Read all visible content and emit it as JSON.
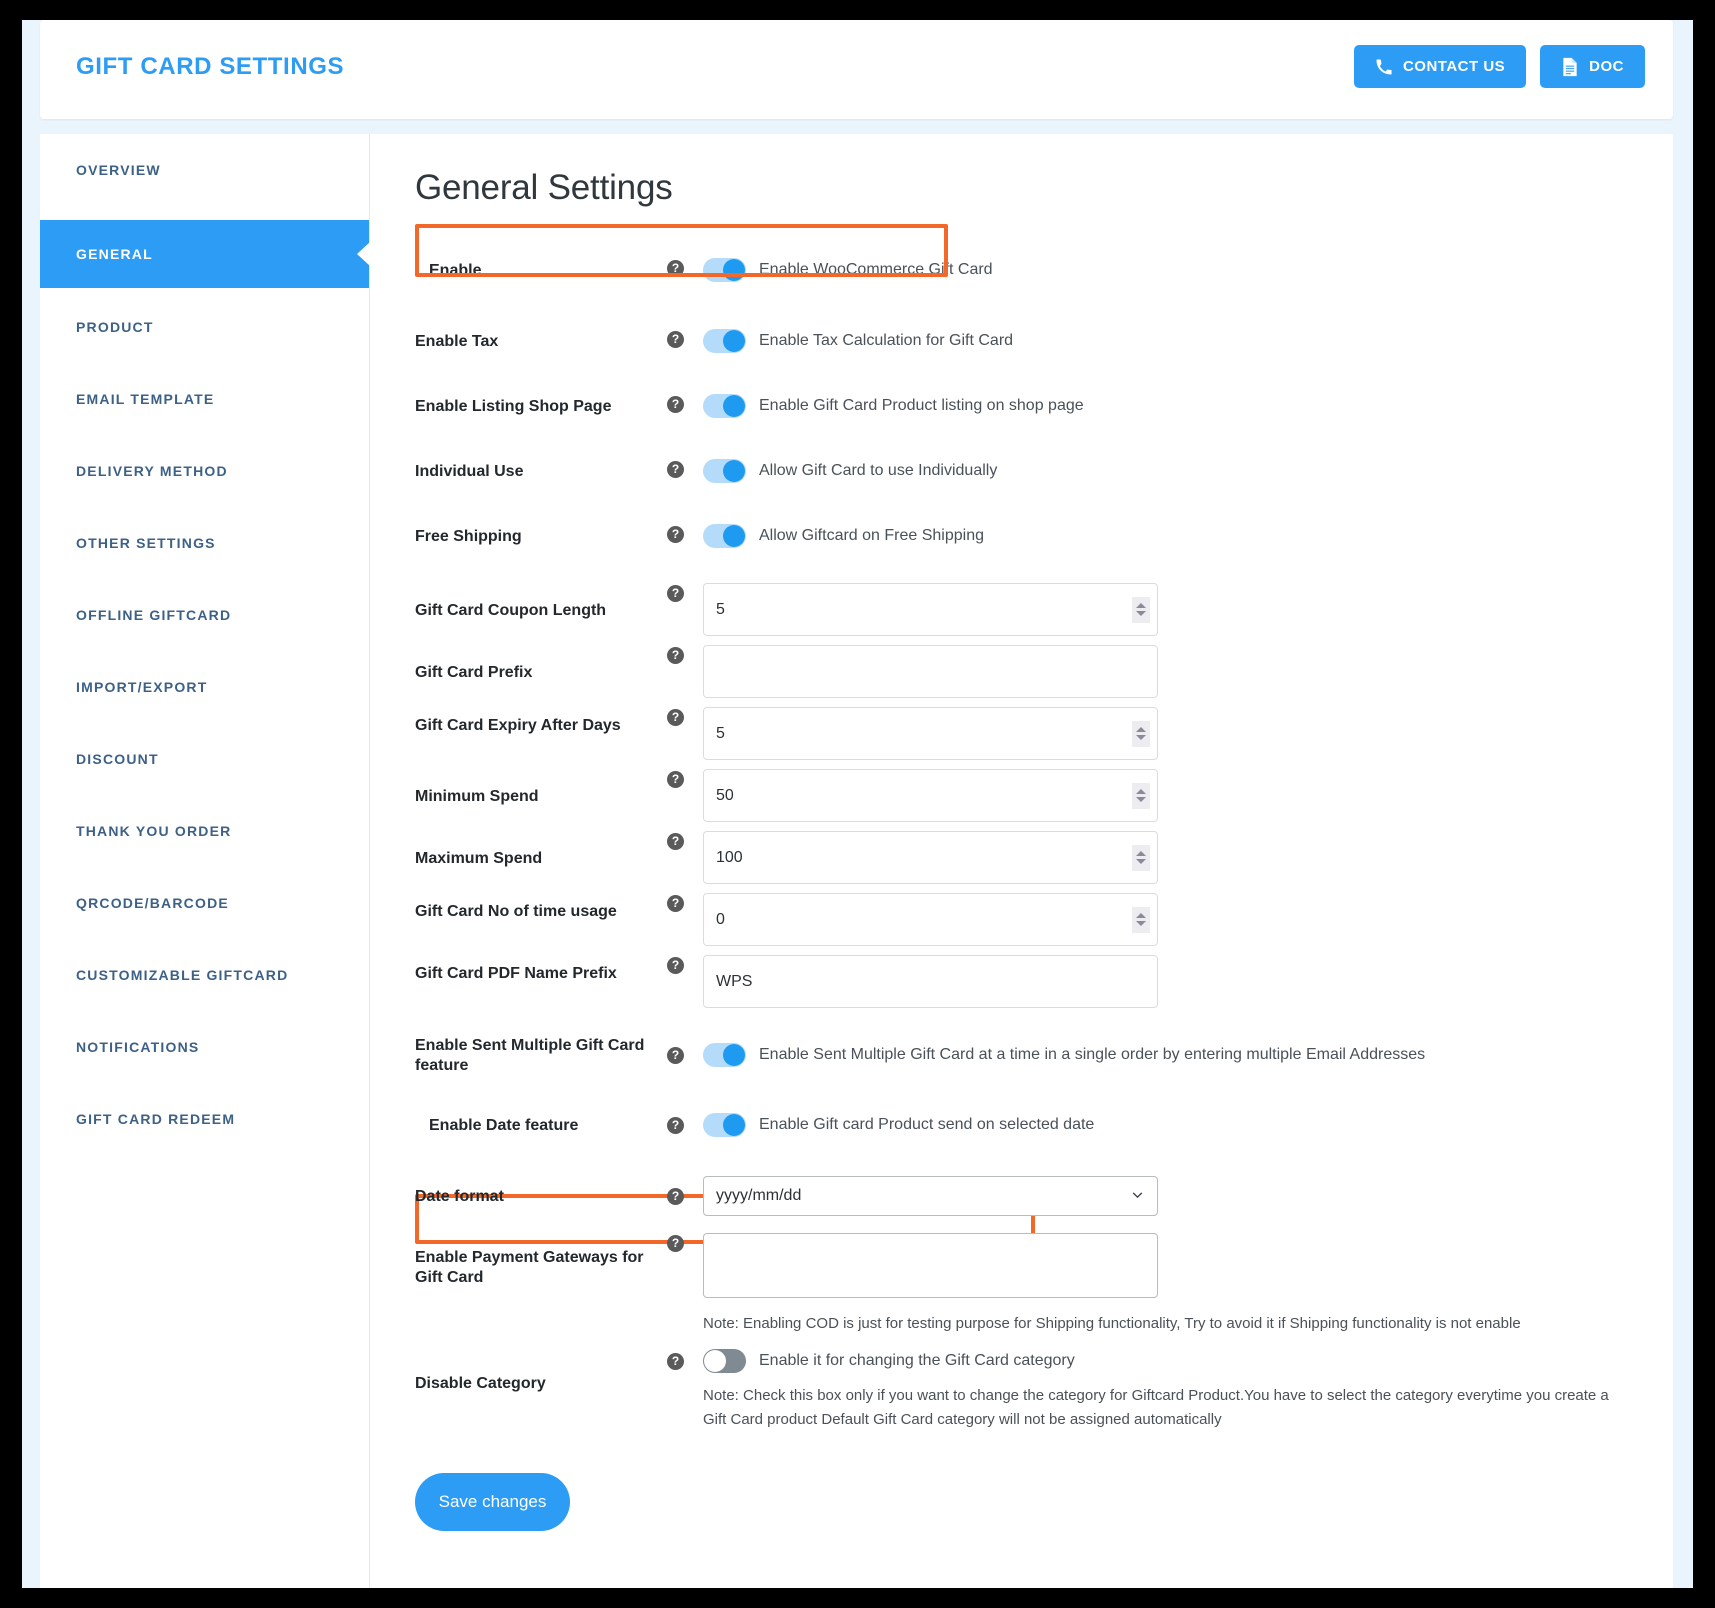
{
  "header": {
    "title": "GIFT CARD SETTINGS",
    "contact_label": "CONTACT US",
    "doc_label": "DOC",
    "accent_color": "#2d9cf5"
  },
  "sidebar": {
    "items": [
      {
        "label": "OVERVIEW",
        "active": false
      },
      {
        "label": "GENERAL",
        "active": true
      },
      {
        "label": "PRODUCT",
        "active": false
      },
      {
        "label": "EMAIL TEMPLATE",
        "active": false
      },
      {
        "label": "DELIVERY METHOD",
        "active": false
      },
      {
        "label": "OTHER SETTINGS",
        "active": false
      },
      {
        "label": "OFFLINE GIFTCARD",
        "active": false
      },
      {
        "label": "IMPORT/EXPORT",
        "active": false
      },
      {
        "label": "DISCOUNT",
        "active": false
      },
      {
        "label": "THANK YOU ORDER",
        "active": false
      },
      {
        "label": "QRCODE/BARCODE",
        "active": false
      },
      {
        "label": "CUSTOMIZABLE GIFTCARD",
        "active": false
      },
      {
        "label": "NOTIFICATIONS",
        "active": false
      },
      {
        "label": "GIFT CARD REDEEM",
        "active": false
      }
    ]
  },
  "main": {
    "title": "General Settings",
    "help_glyph": "?",
    "rows": {
      "enable": {
        "label": "Enable",
        "toggle_text": "Enable WooCommerce Gift Card",
        "toggle_on": true,
        "highlighted": true
      },
      "enable_tax": {
        "label": "Enable Tax",
        "toggle_text": "Enable Tax Calculation for Gift Card",
        "toggle_on": true
      },
      "enable_listing_shop_page": {
        "label": "Enable Listing Shop Page",
        "toggle_text": "Enable Gift Card Product listing on shop page",
        "toggle_on": true
      },
      "individual_use": {
        "label": "Individual Use",
        "toggle_text": "Allow Gift Card to use Individually",
        "toggle_on": true
      },
      "free_shipping": {
        "label": "Free Shipping",
        "toggle_text": "Allow Giftcard on Free Shipping",
        "toggle_on": true
      },
      "coupon_length": {
        "label": "Gift Card Coupon Length",
        "value": "5"
      },
      "prefix": {
        "label": "Gift Card Prefix",
        "value": ""
      },
      "expiry_days": {
        "label": "Gift Card Expiry After Days",
        "value": "5"
      },
      "minimum_spend": {
        "label": "Minimum Spend",
        "value": "50"
      },
      "maximum_spend": {
        "label": "Maximum Spend",
        "value": "100"
      },
      "no_of_time_usage": {
        "label": "Gift Card No of time usage",
        "value": "0"
      },
      "pdf_name_prefix": {
        "label": "Gift Card PDF Name Prefix",
        "value": "WPS"
      },
      "sent_multiple": {
        "label": "Enable Sent Multiple Gift Card feature",
        "toggle_text": "Enable Sent Multiple Gift Card at a time in a single order by entering multiple Email Addresses",
        "toggle_on": true
      },
      "date_feature": {
        "label": "Enable Date feature",
        "toggle_text": "Enable Gift card Product send on selected date",
        "toggle_on": true,
        "highlighted": true
      },
      "date_format": {
        "label": "Date format",
        "value": "yyyy/mm/dd",
        "options": [
          "yyyy/mm/dd"
        ]
      },
      "payment_gateways": {
        "label": "Enable Payment Gateways for Gift Card",
        "value": "",
        "note": "Note: Enabling COD is just for testing purpose for Shipping functionality, Try to avoid it if Shipping functionality is not enable"
      },
      "disable_category": {
        "label": "Disable Category",
        "toggle_text": "Enable it for changing the Gift Card category",
        "toggle_on": false,
        "note_line1": "Note: Check this box only if you want to change the category for Giftcard Product.You have to select the category everytime you create a",
        "note_line2": "Gift Card product Default Gift Card category will not be assigned automatically"
      }
    },
    "save_label": "Save changes",
    "highlight_color": "#f2682a"
  }
}
